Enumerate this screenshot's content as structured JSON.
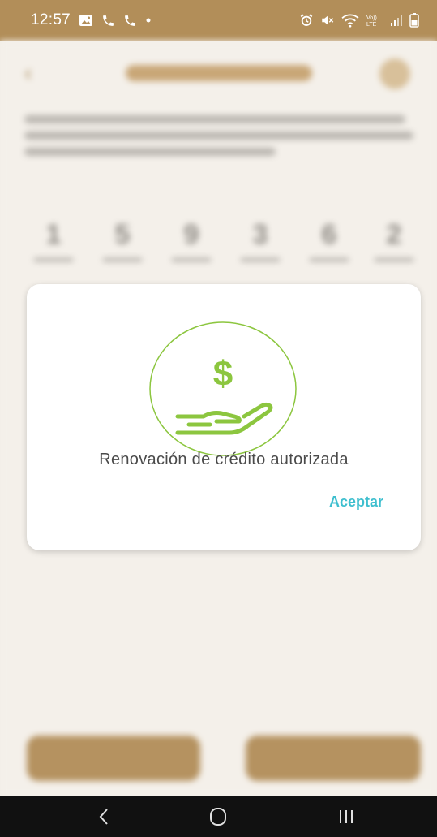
{
  "status_bar": {
    "time": "12:57",
    "left_icons": [
      "image-icon",
      "phone-icon",
      "phone-icon",
      "dot-icon"
    ],
    "right_icons": [
      "alarm-icon",
      "mute-icon",
      "wifi-icon",
      "volte-lte-icon",
      "signal-icon",
      "battery-icon"
    ],
    "color": "#b28e59"
  },
  "dialog": {
    "icon": "hand-dollar-icon",
    "message": "Renovación de crédito autorizada",
    "accept_label": "Aceptar",
    "accent_color": "#3fbfcf",
    "icon_color": "#8cc63f"
  },
  "nav_bar": {
    "buttons": [
      "back-icon",
      "home-icon",
      "recents-icon"
    ]
  }
}
